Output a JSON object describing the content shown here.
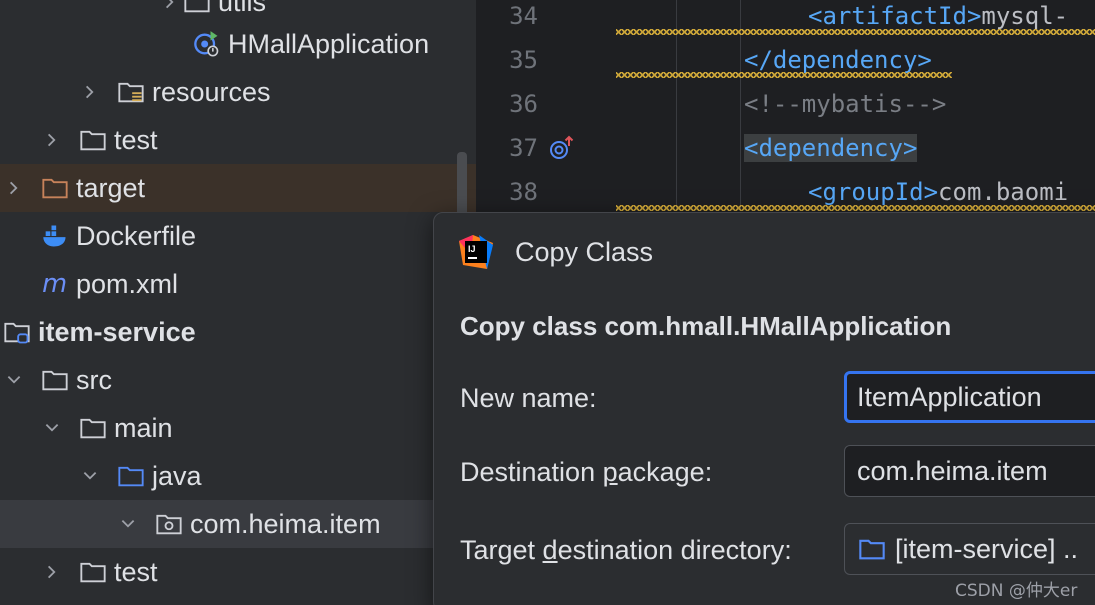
{
  "tree": {
    "items": [
      {
        "label": "utils"
      },
      {
        "label": "HMallApplication"
      },
      {
        "label": "resources"
      },
      {
        "label": "test"
      },
      {
        "label": "target"
      },
      {
        "label": "Dockerfile"
      },
      {
        "label": "pom.xml"
      },
      {
        "label": "item-service"
      },
      {
        "label": "src"
      },
      {
        "label": "main"
      },
      {
        "label": "java"
      },
      {
        "label": "com.heima.item"
      },
      {
        "label": "test"
      }
    ]
  },
  "editor": {
    "lines": [
      {
        "num": "34",
        "open": "<artifactId>",
        "text": "mysql-"
      },
      {
        "num": "35",
        "close": "</dependency>"
      },
      {
        "num": "36",
        "comment": "<!--mybatis-->"
      },
      {
        "num": "37",
        "open": "<dependency>"
      },
      {
        "num": "38",
        "open": "<groupId>",
        "text": "com.baomi"
      }
    ]
  },
  "dialog": {
    "title": "Copy Class",
    "heading": "Copy class com.hmall.HMallApplication",
    "new_name_label": {
      "pre": "New name:",
      "u": "",
      "post": ""
    },
    "new_name_value": "ItemApplication",
    "dest_pkg_label": {
      "pre": "Destination ",
      "u": "p",
      "post": "ackage:"
    },
    "dest_pkg_value": "com.heima.item",
    "target_dir_label": {
      "pre": "Target ",
      "u": "d",
      "post": "estination directory:"
    },
    "target_dir_value": "[item-service] .."
  },
  "watermark": "CSDN @仲大er",
  "colors": {
    "tag": "#57a7f6",
    "accent_focus": "#3574f0",
    "folder_orange": "#c7825a",
    "warning_squiggle": "#c9a338"
  }
}
